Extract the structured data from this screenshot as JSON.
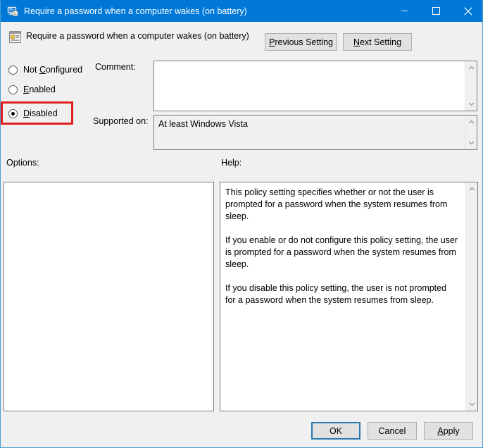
{
  "window": {
    "title": "Require a password when a computer wakes (on battery)",
    "icon": "computer-policy-icon",
    "minimize_glyph": "–",
    "maximize_glyph": "☐",
    "close_glyph": "✕",
    "titlebar_color": "#0078d7",
    "border_color": "#4a9fd4"
  },
  "header": {
    "icon": "policy-setting-icon",
    "title": "Require a password when a computer wakes (on battery)",
    "previous_setting_label_pre": "",
    "previous_setting_accel": "P",
    "previous_setting_label_post": "revious Setting",
    "next_setting_label_pre": "",
    "next_setting_accel": "N",
    "next_setting_label_post": "ext Setting"
  },
  "state_options": {
    "selected": "Disabled",
    "highlight_color": "#e02020",
    "items": [
      {
        "id": "not-configured",
        "pre": "Not ",
        "accel": "C",
        "post": "onfigured",
        "checked": false
      },
      {
        "id": "enabled",
        "pre": "",
        "accel": "E",
        "post": "nabled",
        "checked": false
      },
      {
        "id": "disabled",
        "pre": "",
        "accel": "D",
        "post": "isabled",
        "checked": true
      }
    ]
  },
  "comment": {
    "label": "Comment:",
    "value": "",
    "placeholder": ""
  },
  "supported_on": {
    "label": "Supported on:",
    "value": "At least Windows Vista"
  },
  "options": {
    "label": "Options:",
    "content": ""
  },
  "help": {
    "label": "Help:",
    "paragraphs": [
      "This policy setting specifies whether or not the user is prompted for a password when the system resumes from sleep.",
      "If you enable or do not configure this policy setting, the user is prompted for a password when the system resumes from sleep.",
      "If you disable this policy setting, the user is not prompted for a password when the system resumes from sleep."
    ]
  },
  "footer": {
    "ok_label": "OK",
    "cancel_label": "Cancel",
    "apply_label_pre": "",
    "apply_accel": "A",
    "apply_label_post": "pply",
    "focus_color": "#2a7ab0"
  }
}
